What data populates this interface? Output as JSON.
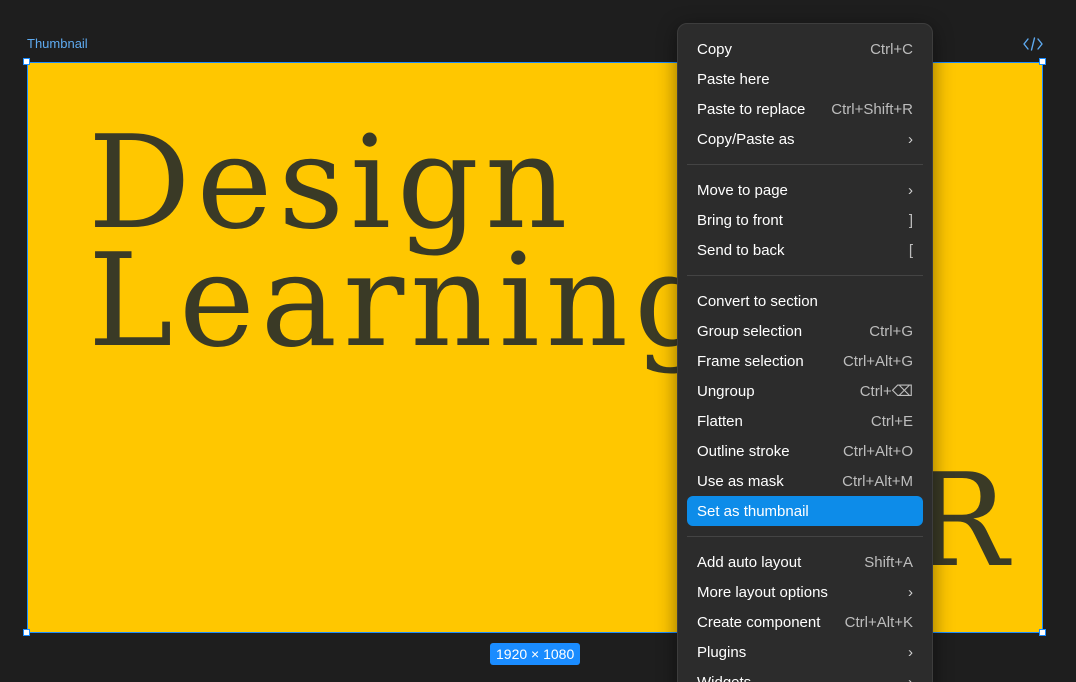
{
  "frame": {
    "label": "Thumbnail",
    "size_badge": "1920 × 1080",
    "headline_line1": "Design",
    "headline_line2": "Learning",
    "partial_letter": "R"
  },
  "colors": {
    "canvas": "#1e1e1e",
    "frame_fill": "#ffc700",
    "headline": "#3a3a26",
    "selection": "#1a8cff",
    "menu_bg": "#2c2c2c",
    "menu_highlight": "#0d8ce9"
  },
  "menu": {
    "groups": [
      [
        {
          "label": "Copy",
          "shortcut": "Ctrl+C"
        },
        {
          "label": "Paste here",
          "shortcut": ""
        },
        {
          "label": "Paste to replace",
          "shortcut": "Ctrl+Shift+R"
        },
        {
          "label": "Copy/Paste as",
          "shortcut": "",
          "submenu": true
        }
      ],
      [
        {
          "label": "Move to page",
          "shortcut": "",
          "submenu": true
        },
        {
          "label": "Bring to front",
          "shortcut": "]"
        },
        {
          "label": "Send to back",
          "shortcut": "["
        }
      ],
      [
        {
          "label": "Convert to section",
          "shortcut": ""
        },
        {
          "label": "Group selection",
          "shortcut": "Ctrl+G"
        },
        {
          "label": "Frame selection",
          "shortcut": "Ctrl+Alt+G"
        },
        {
          "label": "Ungroup",
          "shortcut": "Ctrl+⌫"
        },
        {
          "label": "Flatten",
          "shortcut": "Ctrl+E"
        },
        {
          "label": "Outline stroke",
          "shortcut": "Ctrl+Alt+O"
        },
        {
          "label": "Use as mask",
          "shortcut": "Ctrl+Alt+M"
        },
        {
          "label": "Set as thumbnail",
          "shortcut": "",
          "active": true
        }
      ],
      [
        {
          "label": "Add auto layout",
          "shortcut": "Shift+A"
        },
        {
          "label": "More layout options",
          "shortcut": "",
          "submenu": true
        },
        {
          "label": "Create component",
          "shortcut": "Ctrl+Alt+K"
        },
        {
          "label": "Plugins",
          "shortcut": "",
          "submenu": true
        },
        {
          "label": "Widgets",
          "shortcut": "",
          "submenu": true
        }
      ]
    ]
  },
  "icons": {
    "code": "code-icon",
    "submenu": "chevron-right-icon"
  }
}
